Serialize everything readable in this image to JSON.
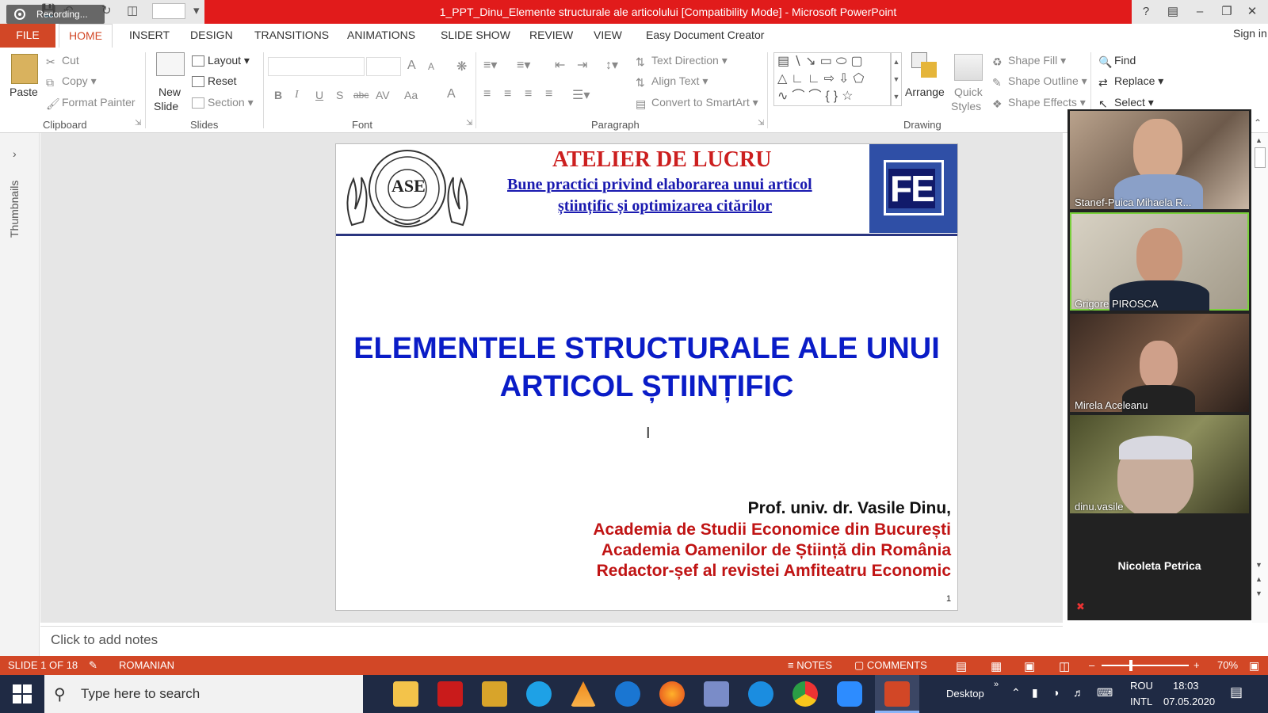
{
  "window": {
    "title": "1_PPT_Dinu_Elemente structurale ale articolului [Compatibility Mode] - Microsoft PowerPoint",
    "recording_label": "Recording...",
    "help": "?",
    "sign_in": "Sign in"
  },
  "tabs": [
    "FILE",
    "HOME",
    "INSERT",
    "DESIGN",
    "TRANSITIONS",
    "ANIMATIONS",
    "SLIDE SHOW",
    "REVIEW",
    "VIEW",
    "Easy Document Creator"
  ],
  "ribbon": {
    "clipboard": {
      "paste": "Paste",
      "cut": "Cut",
      "copy": "Copy",
      "format_painter": "Format Painter",
      "group": "Clipboard"
    },
    "slides": {
      "new_slide_1": "New",
      "new_slide_2": "Slide",
      "layout": "Layout",
      "reset": "Reset",
      "section": "Section",
      "group": "Slides"
    },
    "font": {
      "bold": "B",
      "italic": "I",
      "underline": "U",
      "shadow": "S",
      "strike": "abc",
      "spacing": "AV",
      "case": "Aa",
      "color": "A",
      "grow": "A",
      "shrink": "A",
      "group": "Font"
    },
    "paragraph": {
      "text_direction": "Text Direction",
      "align_text": "Align Text",
      "convert_smartart": "Convert to SmartArt",
      "group": "Paragraph"
    },
    "drawing": {
      "arrange": "Arrange",
      "quick_styles_1": "Quick",
      "quick_styles_2": "Styles",
      "shape_fill": "Shape Fill",
      "shape_outline": "Shape Outline",
      "shape_effects": "Shape Effects",
      "group": "Drawing"
    },
    "editing": {
      "find": "Find",
      "replace": "Replace",
      "select": "Select"
    }
  },
  "thumbnails_label": "Thumbnails",
  "slide": {
    "header_title": "ATELIER DE LUCRU",
    "header_sub1": "Bune practici privind elaborarea unui articol",
    "header_sub2": "științific și optimizarea citărilor",
    "logo_text": "FE",
    "seal_text": "ASE",
    "main_line1": "ELEMENTELE STRUCTURALE ALE UNUI",
    "main_line2": "ARTICOL ȘTIINȚIFIC",
    "author": "Prof. univ. dr. Vasile Dinu,",
    "aff1": "Academia de Studii Economice din București",
    "aff2": "Academia Oamenilor de Știință din România",
    "aff3": "Redactor-șef al revistei Amfiteatru Economic",
    "page_number": "1"
  },
  "notes_placeholder": "Click to add notes",
  "participants": [
    {
      "name": "Stanef-Puica Mihaela R..."
    },
    {
      "name": "Grigore PIROSCA"
    },
    {
      "name": "Mirela Aceleanu"
    },
    {
      "name": "dinu.vasile"
    },
    {
      "name": "Nicoleta Petrica"
    }
  ],
  "status": {
    "slide_info": "SLIDE 1 OF 18",
    "language": "ROMANIAN",
    "notes": "NOTES",
    "comments": "COMMENTS",
    "zoom": "70%",
    "zoom_level_percent": 70
  },
  "taskbar": {
    "search_placeholder": "Type here to search",
    "desktop": "Desktop",
    "lang1": "ROU",
    "lang2": "INTL",
    "time": "18:03",
    "date": "07.05.2020"
  },
  "colors": {
    "accent": "#d24726",
    "title_red": "#e11b1b",
    "slide_blue": "#0a1cc7",
    "slide_red": "#c01414"
  }
}
